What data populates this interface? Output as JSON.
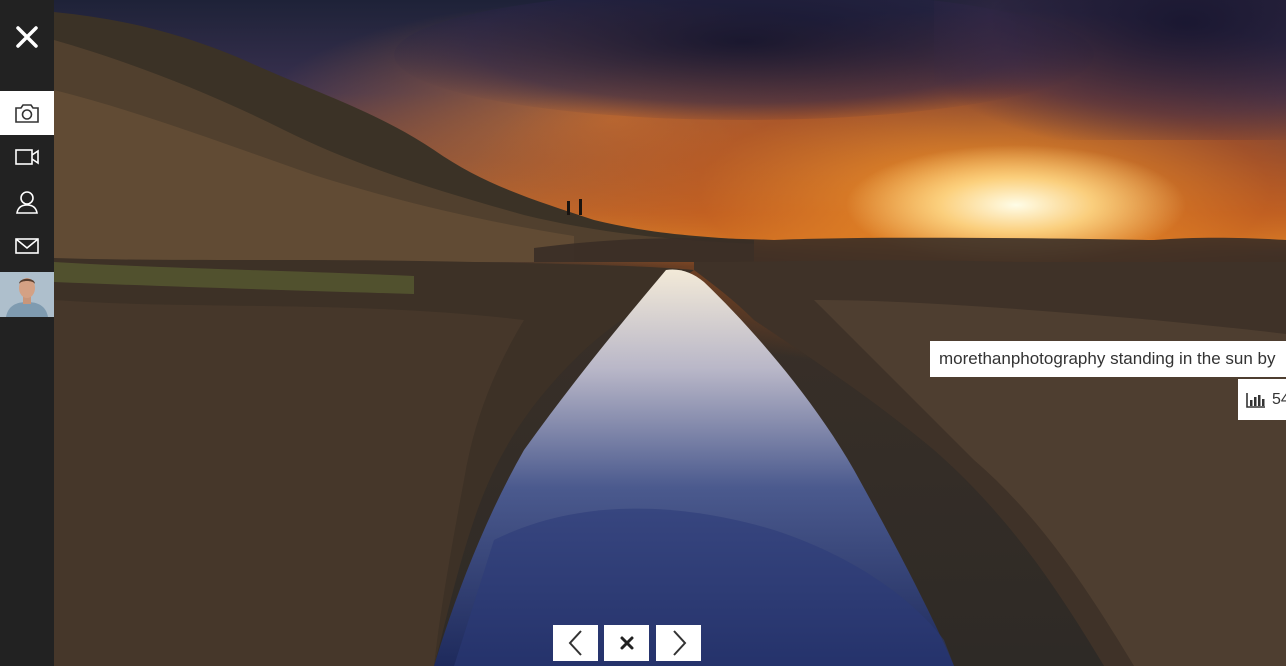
{
  "photo": {
    "alt_icon": "sunset-rockpool-photo"
  },
  "sidebar": {
    "close_icon": "close-icon",
    "items": [
      {
        "icon": "camera-icon",
        "active": true
      },
      {
        "icon": "video-icon",
        "active": false
      },
      {
        "icon": "user-icon",
        "active": false
      },
      {
        "icon": "mail-icon",
        "active": false
      }
    ],
    "avatar_icon": "avatar"
  },
  "caption": {
    "text": "morethanphotography standing in the sun by"
  },
  "stats": {
    "icon": "bar-chart-icon",
    "value": "54"
  },
  "nav": {
    "prev_icon": "chevron-left-icon",
    "close_icon": "close-icon",
    "next_icon": "chevron-right-icon"
  },
  "colors": {
    "sidebar_bg": "#222222",
    "active_item_bg": "#ffffff",
    "caption_bg": "#ffffff",
    "caption_text": "#333333"
  }
}
